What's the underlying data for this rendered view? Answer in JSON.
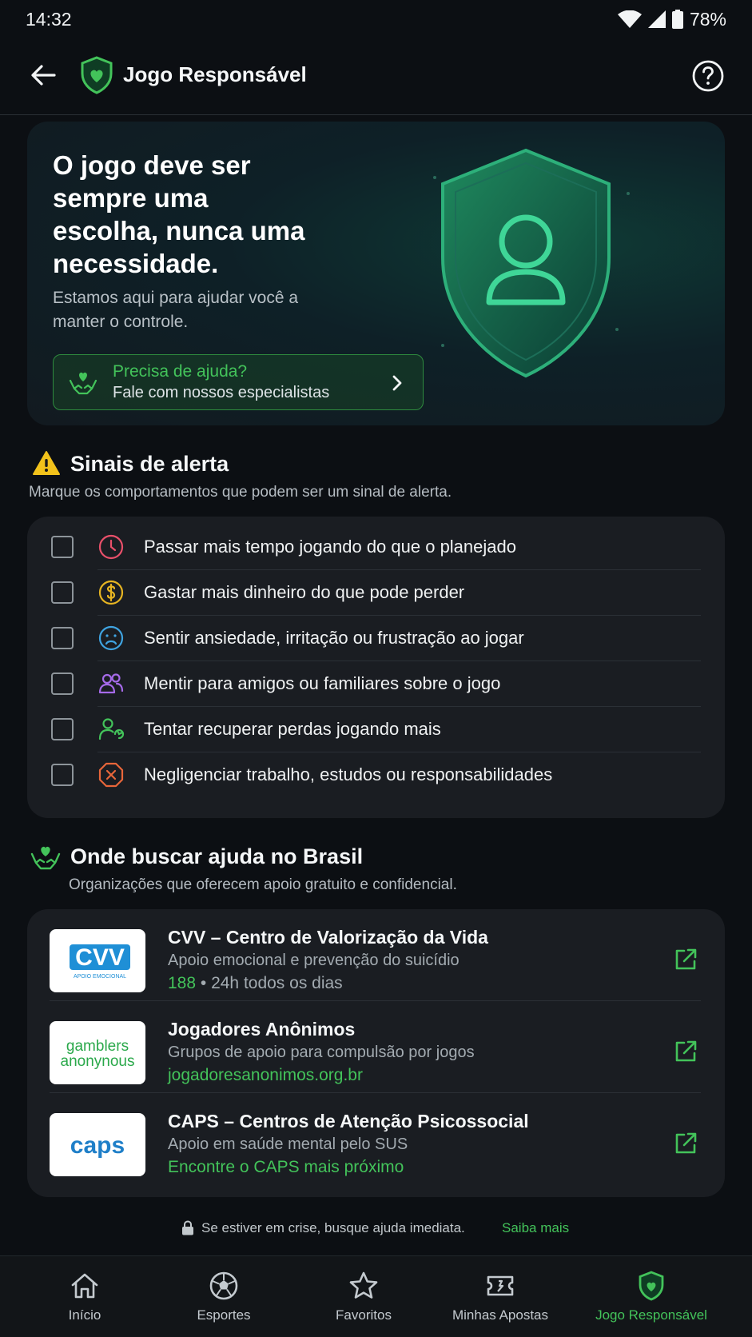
{
  "status_bar": {
    "time": "14:32",
    "battery": "78%"
  },
  "app_bar": {
    "title": "Jogo Responsável"
  },
  "hero": {
    "title": "O jogo deve ser sempre uma escolha, nunca uma necessidade.",
    "subtitle": "Estamos aqui para ajudar você a manter o controle.",
    "help_title": "Precisa de ajuda?",
    "help_subtitle": "Fale com nossos especialistas"
  },
  "warning_section": {
    "title": "Sinais de alerta",
    "subtitle": "Marque os comportamentos que podem ser um sinal de alerta.",
    "items": [
      {
        "label": "Passar mais tempo jogando do que o planejado",
        "icon": "clock-icon",
        "checked": false,
        "color": "#e8506a"
      },
      {
        "label": "Gastar mais dinheiro do que pode perder",
        "icon": "dollar-icon",
        "checked": false,
        "color": "#e6b422"
      },
      {
        "label": "Sentir ansiedade, irritação ou frustração ao jogar",
        "icon": "sad-face-icon",
        "checked": false,
        "color": "#3fa3e0"
      },
      {
        "label": "Mentir para amigos ou familiares sobre o jogo",
        "icon": "users-icon",
        "checked": false,
        "color": "#a56ae8"
      },
      {
        "label": "Tentar recuperar perdas jogando mais",
        "icon": "user-refresh-icon",
        "checked": false,
        "color": "#43c35a"
      },
      {
        "label": "Negligenciar trabalho, estudos ou responsabilidades",
        "icon": "x-octagon-icon",
        "checked": false,
        "color": "#e8663a"
      }
    ]
  },
  "help_section": {
    "title": "Onde buscar ajuda no Brasil",
    "subtitle": "Organizações que oferecem apoio gratuito e confidencial.",
    "orgs": [
      {
        "name": "CVV – Centro de Valorização da Vida",
        "desc": "Apoio emocional e prevenção do suicídio",
        "extra_highlight": "188",
        "extra_rest": " • 24h todos os dias",
        "logo_text": "CVV",
        "logo_sub": "APOIO EMOCIONAL"
      },
      {
        "name": "Jogadores Anônimos",
        "desc": "Grupos de apoio para compulsão por jogos",
        "extra_highlight": "jogadoresanonimos.org.br",
        "extra_rest": "",
        "logo_text": "gamblers",
        "logo_sub": "anonynous"
      },
      {
        "name": "CAPS – Centros de Atenção Psicossocial",
        "desc": "Apoio em saúde mental pelo SUS",
        "extra_highlight": "Encontre o CAPS mais próximo",
        "extra_rest": "",
        "logo_text": "caps",
        "logo_sub": ""
      }
    ]
  },
  "crisis": {
    "text": "Se estiver em crise, busque ajuda imediata.",
    "link": "Saiba mais"
  },
  "bottom_nav": [
    {
      "label": "Início",
      "icon": "home-icon",
      "active": false
    },
    {
      "label": "Esportes",
      "icon": "soccer-ball-icon",
      "active": false
    },
    {
      "label": "Favoritos",
      "icon": "star-icon",
      "active": false
    },
    {
      "label": "Minhas Apostas",
      "icon": "ticket-icon",
      "active": false
    },
    {
      "label": "Jogo Responsável",
      "icon": "shield-heart-icon",
      "active": true
    }
  ],
  "colors": {
    "accent": "#43c35a",
    "background": "#0c0f13",
    "card": "#1a1d22"
  }
}
